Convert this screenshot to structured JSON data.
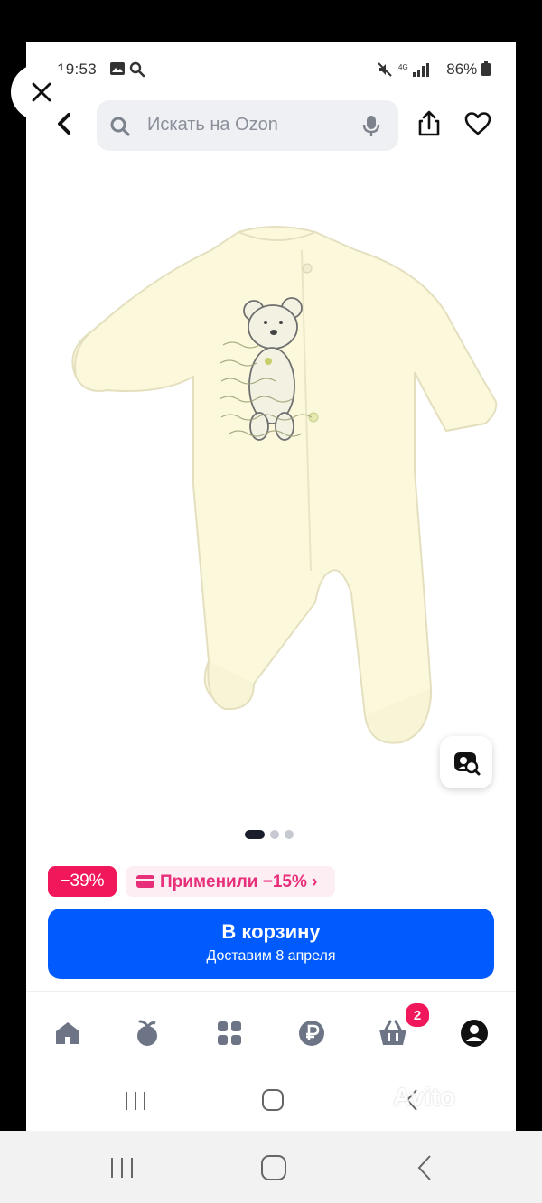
{
  "status_bar": {
    "time": "19:53",
    "battery": "86%"
  },
  "search": {
    "placeholder": "Искать на Ozon"
  },
  "product": {
    "image_alt": "Слип (комбинезон) для новорождённого с мишкой",
    "carousel": {
      "count": 3,
      "active": 0
    }
  },
  "price": {
    "discount": "−39%",
    "promo_label": "Применили −15% ›"
  },
  "cart_button": {
    "label": "В корзину",
    "delivery": "Доставим 8 апреля"
  },
  "bottom_nav": {
    "items": [
      "home-icon",
      "fresh-icon",
      "catalog-icon",
      "finance-icon",
      "cart-icon",
      "profile-icon"
    ],
    "cart_badge": "2"
  },
  "watermark": "Avito",
  "colors": {
    "ozon_blue": "#005bff",
    "discount_pink": "#f0175b",
    "promo_pink": "#e8307a"
  }
}
